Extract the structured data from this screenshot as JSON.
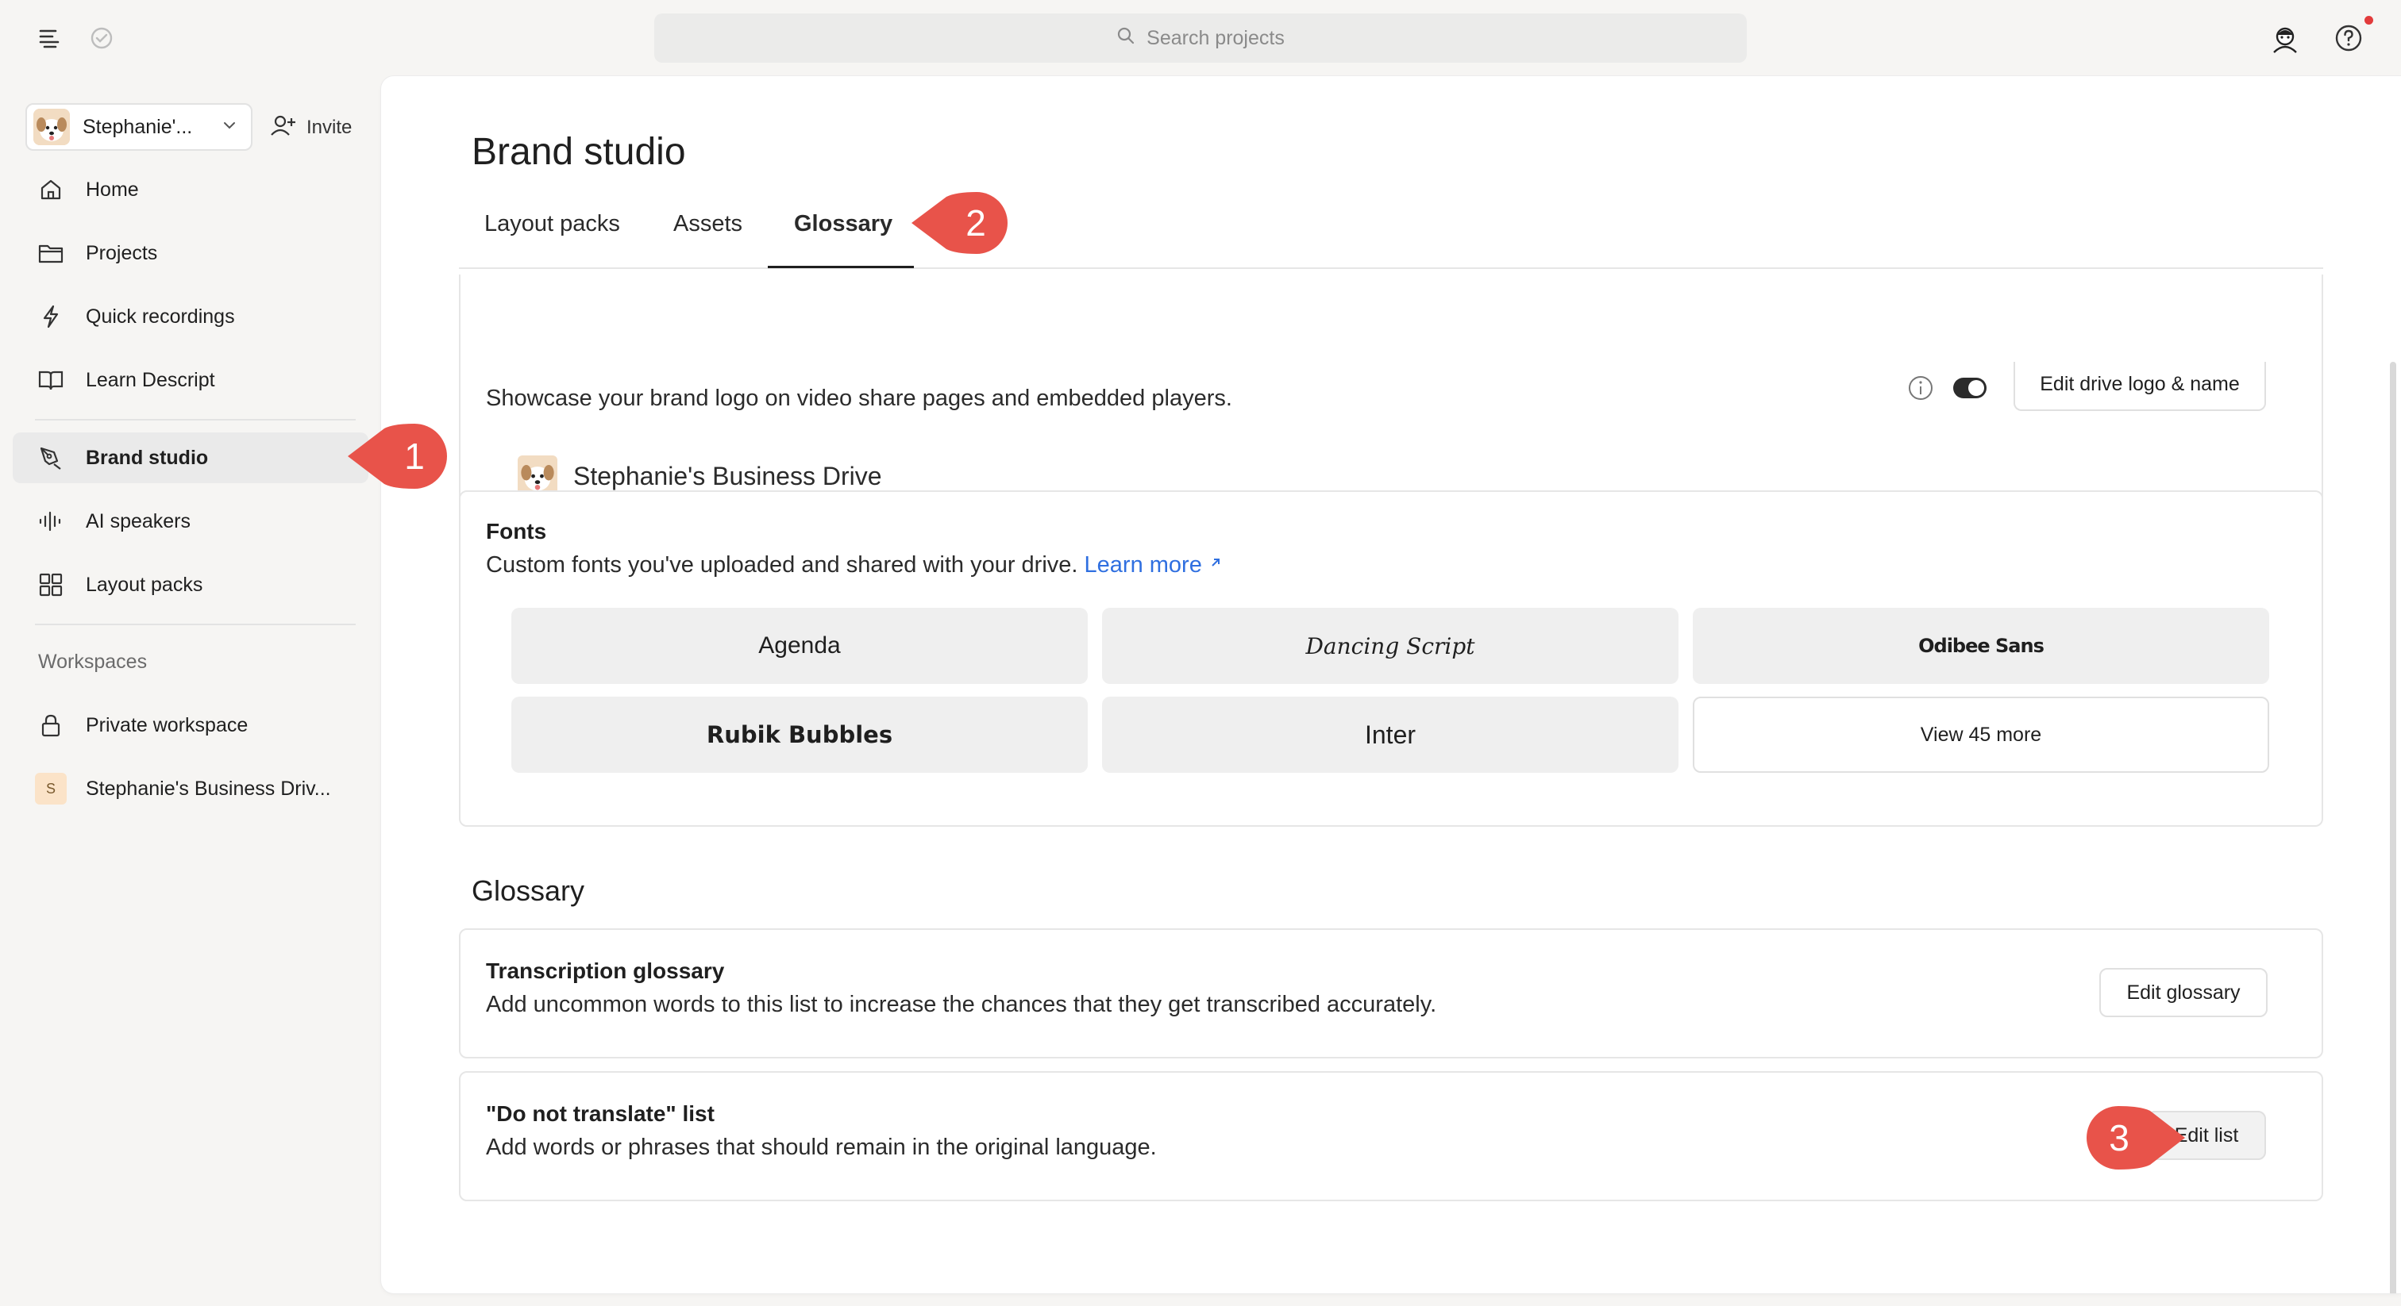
{
  "topbar": {
    "search_placeholder": "Search projects",
    "icons": [
      "menu-icon",
      "sync-status-icon",
      "search-icon",
      "user-avatar-icon",
      "help-icon"
    ]
  },
  "sidebar": {
    "drive_name": "Stephanie'...",
    "invite_label": "Invite",
    "nav": [
      {
        "label": "Home",
        "icon": "home-icon"
      },
      {
        "label": "Projects",
        "icon": "folder-icon"
      },
      {
        "label": "Quick recordings",
        "icon": "lightning-icon"
      },
      {
        "label": "Learn Descript",
        "icon": "book-icon"
      },
      {
        "label": "Brand studio",
        "icon": "pen-tool-icon",
        "active": true
      },
      {
        "label": "AI speakers",
        "icon": "waveform-icon"
      },
      {
        "label": "Layout packs",
        "icon": "grid-icon"
      }
    ],
    "workspaces_label": "Workspaces",
    "workspaces": [
      {
        "label": "Private workspace",
        "icon": "lock-icon"
      },
      {
        "label": "Stephanie's Business Driv...",
        "badge": "S"
      }
    ]
  },
  "main": {
    "title": "Brand studio",
    "tabs": [
      {
        "label": "Layout packs"
      },
      {
        "label": "Assets"
      },
      {
        "label": "Glossary",
        "active": true
      }
    ],
    "logo_card": {
      "description": "Showcase your brand logo on video share pages and embedded players.",
      "drive_name": "Stephanie's Business Drive",
      "edit_button": "Edit drive logo & name"
    },
    "fonts_card": {
      "title": "Fonts",
      "description": "Custom fonts you've uploaded and shared with your drive.",
      "learn_more": "Learn more",
      "fonts": [
        "Agenda",
        "Dancing Script",
        "Odibee Sans",
        "Rubik Bubbles",
        "Inter"
      ],
      "view_more": "View 45 more"
    },
    "glossary_heading": "Glossary",
    "transcription_card": {
      "title": "Transcription glossary",
      "description": "Add uncommon words to this list to increase the chances that they get transcribed accurately.",
      "button": "Edit glossary"
    },
    "dnt_card": {
      "title": "\"Do not translate\" list",
      "description": "Add words or phrases that should remain in the original language.",
      "button": "Edit list"
    }
  },
  "callouts": [
    "1",
    "2",
    "3"
  ],
  "colors": {
    "callout": "#e8534a",
    "link": "#2f6fe0",
    "active_nav_bg": "#eaeaea"
  }
}
